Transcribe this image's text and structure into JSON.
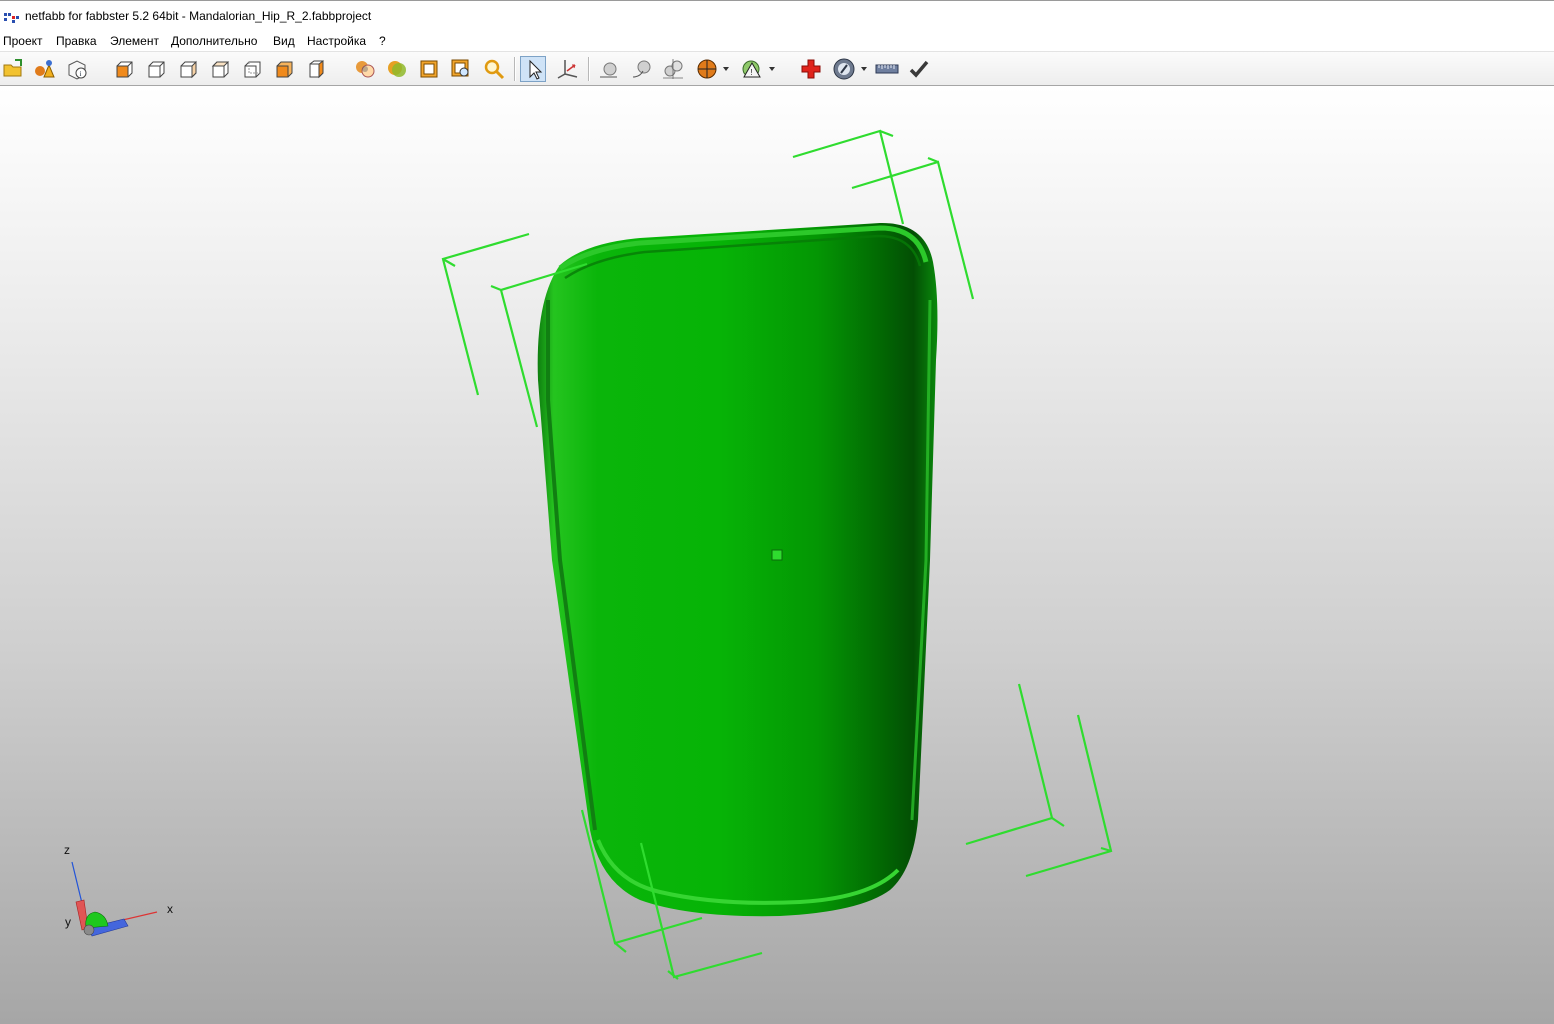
{
  "window": {
    "title": "netfabb for fabbster 5.2 64bit - Mandalorian_Hip_R_2.fabbproject",
    "app_icon": "netfabb-logo-icon"
  },
  "menu": [
    "Проект",
    "Правка",
    "Элемент",
    "Дополнительно",
    "Вид",
    "Настройка",
    "?"
  ],
  "toolbar": {
    "icons": [
      "open-project-icon",
      "add-part-icon",
      "part-info-icon",
      "view-front-icon",
      "view-back-icon",
      "view-left-icon",
      "view-right-icon",
      "view-top-icon",
      "view-bottom-icon",
      "view-perspective-icon",
      "shading-icon",
      "color-icon",
      "wireframe-icon",
      "zoom-selection-icon",
      "zoom-icon",
      "select-cursor-icon",
      "move-axes-icon",
      "sphere-small-icon",
      "sphere-arrow-icon",
      "spheres-scale-icon",
      "section-dropdown-icon",
      "warning-analysis-dropdown-icon",
      "repair-plus-icon",
      "view-options-dropdown-icon",
      "measure-ruler-icon",
      "checkmark-icon"
    ],
    "active_icon": "select-cursor-icon"
  },
  "colors": {
    "model": "#1fc21b",
    "model_dark": "#0a6a0b",
    "bounding_box": "#2fdc2f",
    "axis_x": "#d33",
    "axis_y": "#d33",
    "axis_z": "#2254d8"
  },
  "axis_gizmo": {
    "x_label": "x",
    "y_label": "y",
    "z_label": "z"
  }
}
